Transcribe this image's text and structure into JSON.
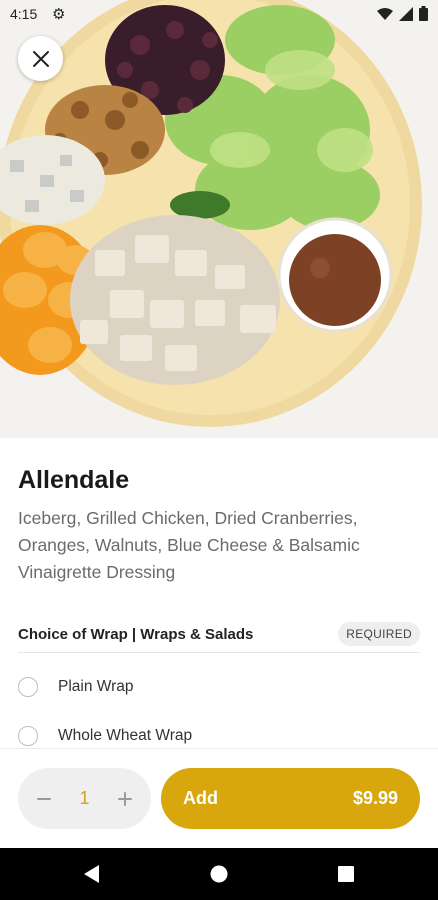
{
  "status_bar": {
    "time": "4:15"
  },
  "item": {
    "name": "Allendale",
    "description": "Iceberg, Grilled Chicken, Dried Cranberries, Oranges, Walnuts, Blue Cheese & Balsamic Vinaigrette Dressing"
  },
  "modifier_group": {
    "title": "Choice of Wrap | Wraps & Salads",
    "badge": "REQUIRED",
    "options": [
      {
        "label": "Plain Wrap",
        "selected": false
      },
      {
        "label": "Whole Wheat Wrap",
        "selected": false
      }
    ]
  },
  "cart": {
    "quantity": "1",
    "add_label": "Add",
    "price": "$9.99"
  },
  "colors": {
    "accent": "#d8a70d",
    "quantity_text": "#d4a11a"
  },
  "icons": {
    "close": "close-icon",
    "minus": "minus-icon",
    "plus": "plus-icon",
    "settings": "gear-icon",
    "wifi": "wifi-icon",
    "signal": "signal-icon",
    "battery": "battery-icon",
    "back": "back-icon",
    "home": "home-icon",
    "recents": "recents-icon"
  }
}
